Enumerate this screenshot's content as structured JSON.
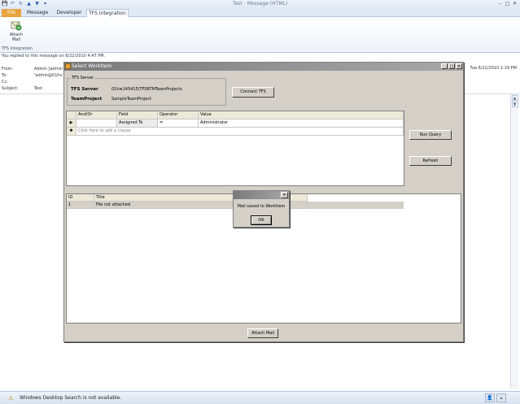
{
  "window": {
    "title": "Test - Message (HTML)",
    "quick_access": [
      "💾",
      "↶",
      "↻",
      "▲",
      "▼",
      "▾"
    ],
    "controls": [
      "–",
      "□",
      "✕"
    ]
  },
  "tabs": [
    {
      "label": "File"
    },
    {
      "label": "Message"
    },
    {
      "label": "Developer"
    },
    {
      "label": "TFS Integration"
    }
  ],
  "ribbon": {
    "attach_label_line1": "Attach",
    "attach_label_line2": "Mail",
    "group_label": "TFS Integration"
  },
  "infobar": {
    "text": "You replied to this message on 6/22/2010 4:47 PM."
  },
  "message_header": {
    "from_label": "From:",
    "from_value": "Admin [admin",
    "to_label": "To:",
    "to_value": "'admin@01hv",
    "cc_label": "Cc:",
    "subject_label": "Subject:",
    "subject_value": "Test",
    "sent": "Tue 6/22/2010 1:19 PM"
  },
  "dialog": {
    "title": "Select WorkItem",
    "controls": [
      "_",
      "□",
      "✕"
    ],
    "tfs_group_label": "TFS Server",
    "tfs_server_label": "TFS Server",
    "tfs_server_value": "01hw145415\\TFSRTMTeamProjects",
    "team_project_label": "TeamProject",
    "team_project_value": "SampleTeamProject",
    "connect_label": "Connect TFS",
    "run_query_label": "Run Query",
    "refresh_label": "Refresh",
    "attach_mail_label": "Attach Mail",
    "query_columns": [
      "And/Or",
      "Field",
      "Operator",
      "Value"
    ],
    "query_rows": [
      {
        "marker": "▶",
        "andor": "",
        "field": "Assigned To",
        "operator": "=",
        "value": "Administrator"
      }
    ],
    "new_row_marker": "✱",
    "new_row_text": "Click here to add a clause",
    "result_columns": [
      "ID",
      "Title"
    ],
    "result_rows": [
      {
        "id": "1",
        "title": "File not attached"
      }
    ]
  },
  "msgbox": {
    "close": "✕",
    "text": "Mail saved to WorkItem",
    "ok_label": "OK"
  },
  "statusbar": {
    "text": "Windows Desktop Search is not available."
  },
  "scroll_arrows": [
    "▲",
    "▼"
  ]
}
